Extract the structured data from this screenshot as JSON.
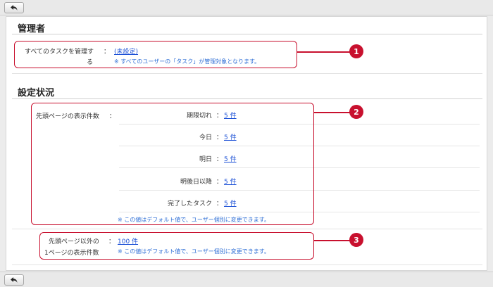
{
  "nav": {
    "back_icon": "back-arrow-icon"
  },
  "admin": {
    "title": "管理者",
    "label_line1": "すべてのタスクを管理す",
    "label_line2": "る",
    "colon": "：",
    "link": "(未設定)",
    "note": "※ すべてのユーザーの「タスク」が管理対象となります。",
    "marker": "1"
  },
  "settings": {
    "title": "設定状況",
    "first_page": {
      "label": "先頭ページの表示件数",
      "colon": "：",
      "rows": [
        {
          "label": "期限切れ",
          "value": "5 件"
        },
        {
          "label": "今日",
          "value": "5 件"
        },
        {
          "label": "明日",
          "value": "5 件"
        },
        {
          "label": "明後日以降",
          "value": "5 件"
        },
        {
          "label": "完了したタスク",
          "value": "5 件"
        }
      ],
      "note": "※ この値はデフォルト値で、ユーザー個別に変更できます。",
      "marker": "2"
    },
    "other_pages": {
      "label_line1": "先頭ページ以外の",
      "label_line2": "1ページの表示件数",
      "colon": "：",
      "value": "100 件",
      "note": "※ この値はデフォルト値で、ユーザー個別に変更できます。",
      "marker": "3"
    }
  },
  "colors": {
    "accent": "#c8102e",
    "link": "#1a4fd6",
    "note": "#2f6fd6"
  }
}
